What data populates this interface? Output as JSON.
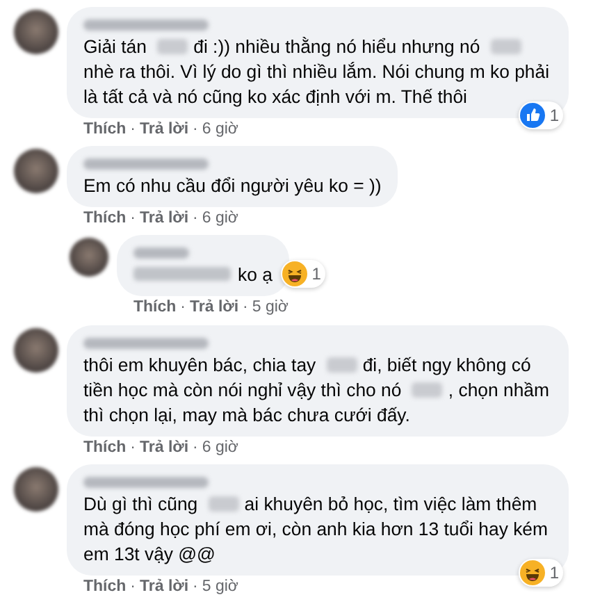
{
  "comments": [
    {
      "body": [
        {
          "kind": "text",
          "text": "Giải tán"
        },
        {
          "kind": "redacted"
        },
        {
          "kind": "text",
          "text": "đi :)) nhiều thằng nó hiểu nhưng nó"
        },
        {
          "kind": "redacted"
        },
        {
          "kind": "text",
          "text": "nhè ra thôi. Vì lý do gì thì nhiều lắm. Nói chung m ko phải là tất cả và nó cũng ko xác định với m. Thế thôi"
        }
      ],
      "reaction": {
        "kind": "like",
        "count": "1"
      },
      "actions": [
        {
          "kind": "link",
          "text": "Thích"
        },
        {
          "kind": "sep",
          "text": "·"
        },
        {
          "kind": "link",
          "text": "Trả lời"
        },
        {
          "kind": "sep",
          "text": "·"
        },
        {
          "kind": "time",
          "text": "6 giờ"
        }
      ]
    },
    {
      "body": [
        {
          "kind": "text",
          "text": "Em có nhu cầu đổi người yêu ko = ))"
        }
      ],
      "actions": [
        {
          "kind": "link",
          "text": "Thích"
        },
        {
          "kind": "sep",
          "text": "·"
        },
        {
          "kind": "link",
          "text": "Trả lời"
        },
        {
          "kind": "sep",
          "text": "·"
        },
        {
          "kind": "time",
          "text": "6 giờ"
        }
      ],
      "children": [
        {
          "body": [
            {
              "kind": "mention"
            },
            {
              "kind": "text",
              "text": "ko ạ"
            }
          ],
          "reaction": {
            "kind": "haha",
            "count": "1"
          },
          "actions": [
            {
              "kind": "link",
              "text": "Thích"
            },
            {
              "kind": "sep",
              "text": "·"
            },
            {
              "kind": "link",
              "text": "Trả lời"
            },
            {
              "kind": "sep",
              "text": "·"
            },
            {
              "kind": "time",
              "text": "5 giờ"
            }
          ]
        }
      ]
    },
    {
      "body": [
        {
          "kind": "text",
          "text": "thôi em khuyên bác, chia tay"
        },
        {
          "kind": "redacted"
        },
        {
          "kind": "text",
          "text": "đi, biết ngy không có tiền học mà còn nói nghỉ vậy thì cho nó"
        },
        {
          "kind": "redacted"
        },
        {
          "kind": "text",
          "text": ", chọn nhầm thì chọn lại, may mà bác chưa cưới đấy."
        }
      ],
      "actions": [
        {
          "kind": "link",
          "text": "Thích"
        },
        {
          "kind": "sep",
          "text": "·"
        },
        {
          "kind": "link",
          "text": "Trả lời"
        },
        {
          "kind": "sep",
          "text": "·"
        },
        {
          "kind": "time",
          "text": "6 giờ"
        }
      ]
    },
    {
      "body": [
        {
          "kind": "text",
          "text": "Dù gì thì cũng"
        },
        {
          "kind": "redacted"
        },
        {
          "kind": "text",
          "text": "ai khuyên bỏ học, tìm việc làm thêm mà đóng học phí em ơi, còn anh kia hơn 13 tuổi hay kém em 13t vậy @@"
        }
      ],
      "reaction": {
        "kind": "haha",
        "count": "1"
      },
      "actions": [
        {
          "kind": "link",
          "text": "Thích"
        },
        {
          "kind": "sep",
          "text": "·"
        },
        {
          "kind": "link",
          "text": "Trả lời"
        },
        {
          "kind": "sep",
          "text": "·"
        },
        {
          "kind": "time",
          "text": "5 giờ"
        }
      ]
    }
  ]
}
